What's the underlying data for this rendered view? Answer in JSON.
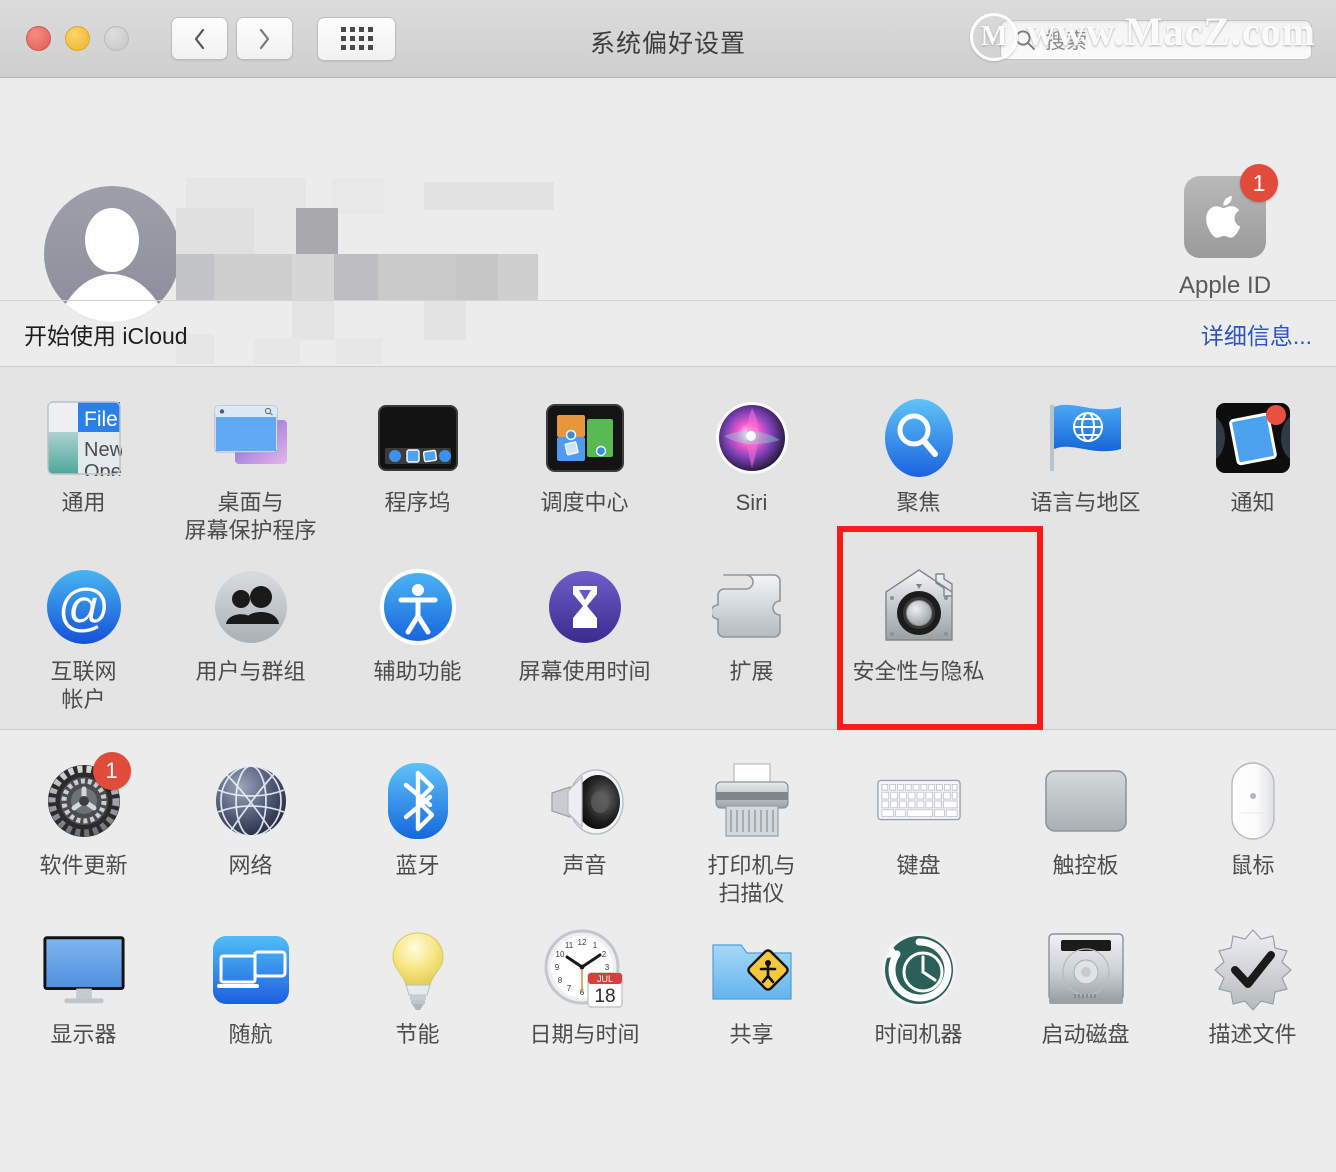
{
  "window": {
    "title": "系统偏好设置",
    "traffic_lights": [
      "close",
      "minimize",
      "zoom"
    ],
    "back_label": "后退",
    "forward_label": "前进",
    "grid_label": "显示全部"
  },
  "search": {
    "placeholder": "搜索",
    "icon": "search-icon"
  },
  "watermark": {
    "text": "www.MacZ.com",
    "logo": "M"
  },
  "account": {
    "avatar": "default-user-avatar",
    "name_redacted": true,
    "apple_id": {
      "label": "Apple ID",
      "badge": "1",
      "icon": "apple-logo-icon"
    }
  },
  "icloud": {
    "label": "开始使用 iCloud",
    "link": "详细信息..."
  },
  "sections": [
    {
      "name": "personal",
      "items": [
        {
          "label": "通用",
          "icon": "general-icon"
        },
        {
          "label": "桌面与\n屏幕保护程序",
          "icon": "desktop-screensaver-icon"
        },
        {
          "label": "程序坞",
          "icon": "dock-icon"
        },
        {
          "label": "调度中心",
          "icon": "mission-control-icon"
        },
        {
          "label": "Siri",
          "icon": "siri-icon"
        },
        {
          "label": "聚焦",
          "icon": "spotlight-icon"
        },
        {
          "label": "语言与地区",
          "icon": "language-region-icon"
        },
        {
          "label": "通知",
          "icon": "notifications-icon"
        },
        {
          "label": "互联网\n帐户",
          "icon": "internet-accounts-icon"
        },
        {
          "label": "用户与群组",
          "icon": "users-groups-icon"
        },
        {
          "label": "辅助功能",
          "icon": "accessibility-icon"
        },
        {
          "label": "屏幕使用时间",
          "icon": "screen-time-icon"
        },
        {
          "label": "扩展",
          "icon": "extensions-icon"
        },
        {
          "label": "安全性与隐私",
          "icon": "security-privacy-icon",
          "highlighted": true
        }
      ]
    },
    {
      "name": "hardware",
      "items": [
        {
          "label": "软件更新",
          "icon": "software-update-icon",
          "badge": "1"
        },
        {
          "label": "网络",
          "icon": "network-icon"
        },
        {
          "label": "蓝牙",
          "icon": "bluetooth-icon"
        },
        {
          "label": "声音",
          "icon": "sound-icon"
        },
        {
          "label": "打印机与\n扫描仪",
          "icon": "printers-scanners-icon"
        },
        {
          "label": "键盘",
          "icon": "keyboard-icon"
        },
        {
          "label": "触控板",
          "icon": "trackpad-icon"
        },
        {
          "label": "鼠标",
          "icon": "mouse-icon"
        },
        {
          "label": "显示器",
          "icon": "displays-icon"
        },
        {
          "label": "随航",
          "icon": "sidecar-icon"
        },
        {
          "label": "节能",
          "icon": "energy-saver-icon"
        },
        {
          "label": "日期与时间",
          "icon": "date-time-icon"
        },
        {
          "label": "共享",
          "icon": "sharing-icon"
        },
        {
          "label": "时间机器",
          "icon": "time-machine-icon"
        },
        {
          "label": "启动磁盘",
          "icon": "startup-disk-icon"
        },
        {
          "label": "描述文件",
          "icon": "profiles-icon"
        }
      ]
    }
  ],
  "date_time_icon": {
    "month": "JUL",
    "day": "18"
  },
  "general_icon": {
    "lines": [
      "File",
      "New",
      "Open"
    ]
  },
  "colors": {
    "highlight": "#ff1b1b",
    "link": "#2c55c1",
    "badge": "#e04b3a",
    "window_bg": "#ececec",
    "pane_bg": "#e4e4e4"
  }
}
